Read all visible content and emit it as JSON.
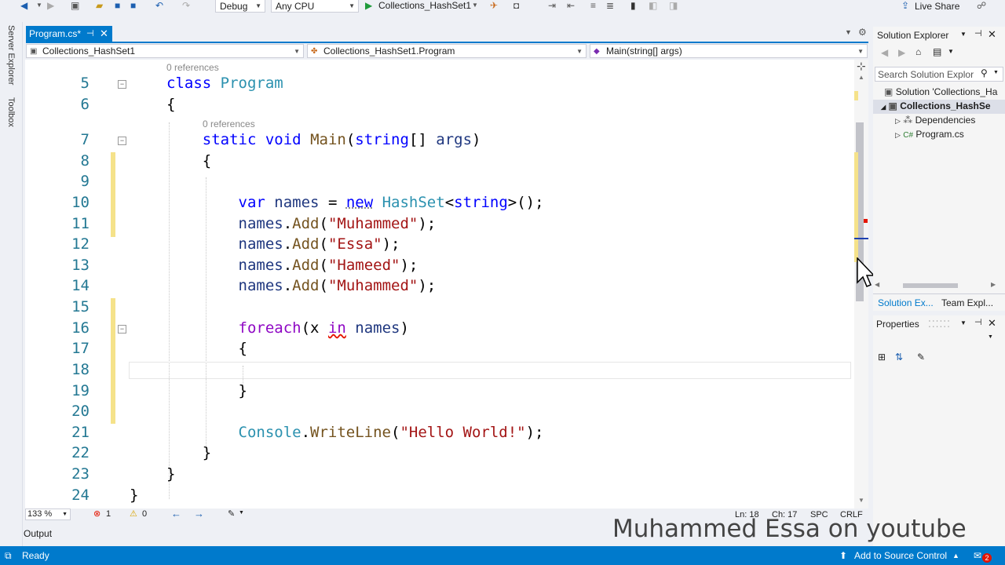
{
  "toolbar": {
    "config": "Debug",
    "platform": "Any CPU",
    "start_target": "Collections_HashSet1",
    "live_share": "Live Share"
  },
  "left_strip": {
    "server_explorer": "Server Explorer",
    "toolbox": "Toolbox"
  },
  "tab": {
    "name": "Program.cs*"
  },
  "nav": {
    "project": "Collections_HashSet1",
    "class": "Collections_HashSet1.Program",
    "member": "Main(string[] args)"
  },
  "editor": {
    "refs_class": "0 references",
    "refs_main": "0 references",
    "line_numbers": [
      "5",
      "6",
      "7",
      "8",
      "9",
      "10",
      "11",
      "12",
      "13",
      "14",
      "15",
      "16",
      "17",
      "18",
      "19",
      "20",
      "21",
      "22",
      "23",
      "24"
    ],
    "l5_kw": "class",
    "l5_name": "Program",
    "brace_open": "{",
    "brace_close": "}",
    "l7_static": "static",
    "l7_void": "void",
    "l7_main": "Main",
    "l7_string": "string",
    "l7_args": "args",
    "l10_var": "var",
    "l10_names": "names",
    "l10_new": "new",
    "l10_type": "HashSet",
    "l10_string": "string",
    "add_obj": "names",
    "add_method": "Add",
    "str_muhammed": "\"Muhammed\"",
    "str_essa": "\"Essa\"",
    "str_hameed": "\"Hameed\"",
    "l16_foreach": "foreach",
    "l16_x": "x",
    "l16_in": "in",
    "l16_names": "names",
    "l21_console": "Console",
    "l21_method": "WriteLine",
    "l21_str": "\"Hello World!\""
  },
  "edit_status": {
    "zoom": "133 %",
    "errors": "1",
    "warnings": "0",
    "line": "Ln: 18",
    "col": "Ch: 17",
    "spc": "SPC",
    "eol": "CRLF"
  },
  "solution_explorer": {
    "title": "Solution Explorer",
    "search_placeholder": "Search Solution Explor",
    "items": [
      {
        "label": "Solution 'Collections_Ha"
      },
      {
        "label": "Collections_HashSe"
      },
      {
        "label": "Dependencies"
      },
      {
        "label": "Program.cs"
      }
    ],
    "tab_solution": "Solution Ex...",
    "tab_team": "Team Expl..."
  },
  "properties": {
    "title": "Properties"
  },
  "output": {
    "label": "Output"
  },
  "statusbar": {
    "ready": "Ready",
    "source_control": "Add to Source Control",
    "notif_count": "2"
  },
  "watermark": "Muhammed Essa on youtube",
  "colors": {
    "accent": "#007acc",
    "keyword": "#0000ff",
    "type": "#2b91af",
    "string": "#a31515"
  }
}
